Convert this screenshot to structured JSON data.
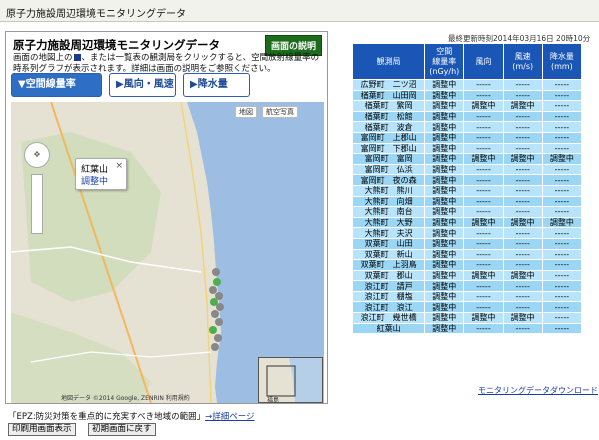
{
  "page": {
    "header_title": "原子力施設周辺環境モニタリングデータ"
  },
  "panel": {
    "title": "原子力施設周辺環境モニタリングデータ",
    "help_button": "画面の説明",
    "description_1": "画面の地図上の",
    "description_2": "、または一覧表の観測局をクリックすると、空間放射線量率の時系列グラフが表示されます。詳細は画面の説明をご参照ください。"
  },
  "tabs": [
    {
      "label": "▼空間線量率",
      "active": true
    },
    {
      "label": "▶風向・風速",
      "active": false
    },
    {
      "label": "▶降水量",
      "active": false
    }
  ],
  "map": {
    "btn_map": "地図",
    "btn_satellite": "航空写真",
    "popup_title": "紅葉山",
    "popup_status": "調整中",
    "popup_close": "×",
    "copyright": "地図データ ©2014 Google, ZENRIN 利用規約",
    "inset_label": "福島"
  },
  "footer": {
    "epz_text": "「EPZ:防災対策を重点的に充実すべき地域の範囲」",
    "epz_link": "→詳細ページ",
    "print_button": "印刷用画面表示",
    "reset_button": "初期画面に戻す"
  },
  "table": {
    "updated": "最終更新時刻2014年03月16日 20時10分",
    "headers": {
      "station": "観測局",
      "dose": "空間\n線量率\n(nGy/h)",
      "wind_dir": "風向",
      "wind_speed": "風速\n(m/s)",
      "rain": "降水量\n(mm)"
    },
    "rows": [
      {
        "station": "広野町　二ツ沼",
        "dose": "調整中",
        "wind_dir": "-----",
        "wind_speed": "-----",
        "rain": "-----"
      },
      {
        "station": "楢葉町　山田岡",
        "dose": "調整中",
        "wind_dir": "-----",
        "wind_speed": "-----",
        "rain": "-----"
      },
      {
        "station": "楢葉町　繁岡",
        "dose": "調整中",
        "wind_dir": "調整中",
        "wind_speed": "調整中",
        "rain": "-----"
      },
      {
        "station": "楢葉町　松館",
        "dose": "調整中",
        "wind_dir": "-----",
        "wind_speed": "-----",
        "rain": "-----"
      },
      {
        "station": "楢葉町　波倉",
        "dose": "調整中",
        "wind_dir": "-----",
        "wind_speed": "-----",
        "rain": "-----"
      },
      {
        "station": "富岡町　上郡山",
        "dose": "調整中",
        "wind_dir": "-----",
        "wind_speed": "-----",
        "rain": "-----"
      },
      {
        "station": "富岡町　下郡山",
        "dose": "調整中",
        "wind_dir": "-----",
        "wind_speed": "-----",
        "rain": "-----"
      },
      {
        "station": "富岡町　富岡",
        "dose": "調整中",
        "wind_dir": "調整中",
        "wind_speed": "調整中",
        "rain": "調整中"
      },
      {
        "station": "富岡町　仏浜",
        "dose": "調整中",
        "wind_dir": "-----",
        "wind_speed": "-----",
        "rain": "-----"
      },
      {
        "station": "富岡町　夜の森",
        "dose": "調整中",
        "wind_dir": "-----",
        "wind_speed": "-----",
        "rain": "-----"
      },
      {
        "station": "大熊町　熊川",
        "dose": "調整中",
        "wind_dir": "-----",
        "wind_speed": "-----",
        "rain": "-----"
      },
      {
        "station": "大熊町　向畑",
        "dose": "調整中",
        "wind_dir": "-----",
        "wind_speed": "-----",
        "rain": "-----"
      },
      {
        "station": "大熊町　南台",
        "dose": "調整中",
        "wind_dir": "-----",
        "wind_speed": "-----",
        "rain": "-----"
      },
      {
        "station": "大熊町　大野",
        "dose": "調整中",
        "wind_dir": "調整中",
        "wind_speed": "調整中",
        "rain": "調整中"
      },
      {
        "station": "大熊町　夫沢",
        "dose": "調整中",
        "wind_dir": "-----",
        "wind_speed": "-----",
        "rain": "-----"
      },
      {
        "station": "双葉町　山田",
        "dose": "調整中",
        "wind_dir": "-----",
        "wind_speed": "-----",
        "rain": "-----"
      },
      {
        "station": "双葉町　新山",
        "dose": "調整中",
        "wind_dir": "-----",
        "wind_speed": "-----",
        "rain": "-----"
      },
      {
        "station": "双葉町　上羽鳥",
        "dose": "調整中",
        "wind_dir": "-----",
        "wind_speed": "-----",
        "rain": "-----"
      },
      {
        "station": "双葉町　郡山",
        "dose": "調整中",
        "wind_dir": "調整中",
        "wind_speed": "調整中",
        "rain": "-----"
      },
      {
        "station": "浪江町　請戸",
        "dose": "調整中",
        "wind_dir": "-----",
        "wind_speed": "-----",
        "rain": "-----"
      },
      {
        "station": "浪江町　棚塩",
        "dose": "調整中",
        "wind_dir": "-----",
        "wind_speed": "-----",
        "rain": "-----"
      },
      {
        "station": "浪江町　浪江",
        "dose": "調整中",
        "wind_dir": "-----",
        "wind_speed": "-----",
        "rain": "-----"
      },
      {
        "station": "浪江町　幾世橋",
        "dose": "調整中",
        "wind_dir": "調整中",
        "wind_speed": "調整中",
        "rain": "-----"
      },
      {
        "station": "紅葉山",
        "dose": "調整中",
        "wind_dir": "-----",
        "wind_speed": "-----",
        "rain": "-----"
      }
    ],
    "download_link": "モニタリングデータダウンロード"
  },
  "colors": {
    "header_blue": "#1a56b6",
    "row_light": "#b7e4fa",
    "row_dark": "#9bd7f5",
    "help_green": "#1d6b1d",
    "tab_blue": "#2e6ec4"
  }
}
